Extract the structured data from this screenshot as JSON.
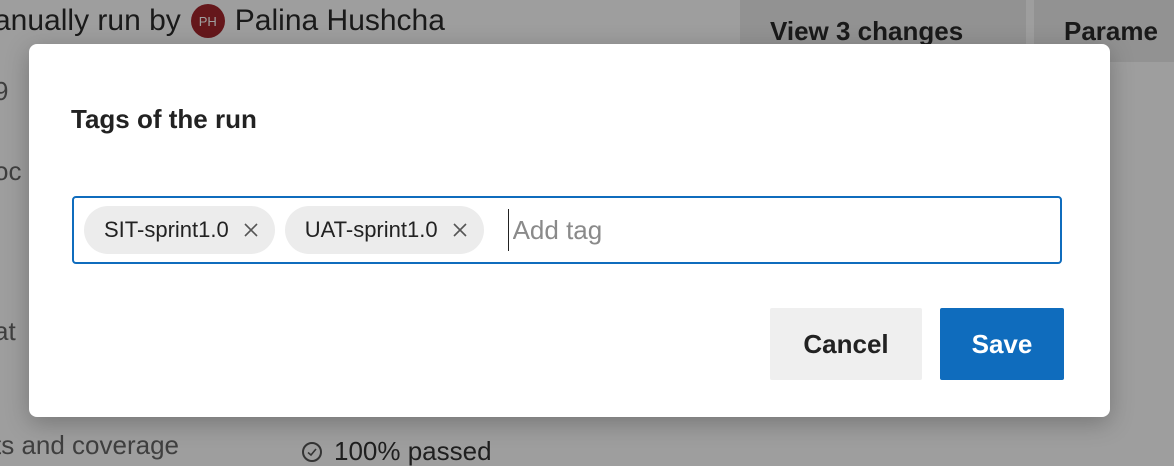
{
  "background": {
    "run_text": "anually run by",
    "avatar_initials": "PH",
    "user_name": "Palina Hushcha",
    "view_changes_label": "View 3 changes",
    "parameters_label": "Parame",
    "side_fragment_1": "9",
    "side_fragment_2": "oc",
    "side_fragment_3": "at",
    "tests_label": "ts and coverage",
    "tests_status": "100% passed"
  },
  "dialog": {
    "title": "Tags of the run",
    "tags": [
      {
        "label": "SIT-sprint1.0"
      },
      {
        "label": "UAT-sprint1.0"
      }
    ],
    "input_placeholder": "Add tag",
    "input_value": "",
    "cancel_label": "Cancel",
    "save_label": "Save"
  },
  "colors": {
    "accent": "#0f6cbd",
    "avatar": "#a4262c",
    "tag_background": "#ececec"
  }
}
